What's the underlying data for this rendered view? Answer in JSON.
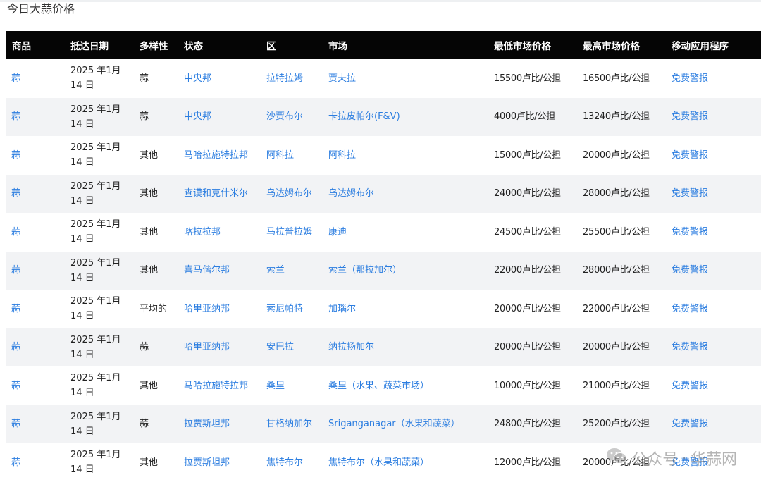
{
  "heading": "今日大蒜价格",
  "columns": [
    "商品",
    "抵达日期",
    "多样性",
    "状态",
    "区",
    "市场",
    "最低市场价格",
    "最高市场价格",
    "移动应用程序"
  ],
  "rows": [
    {
      "commodity": "蒜",
      "date": "2025 年1月 14 日",
      "variety": "蒜",
      "state": "中央邦",
      "district": "拉特拉姆",
      "market": "贾夫拉",
      "min": "15500卢比/公担",
      "max": "16500卢比/公担",
      "app": "免费警报"
    },
    {
      "commodity": "蒜",
      "date": "2025 年1月 14 日",
      "variety": "蒜",
      "state": "中央邦",
      "district": "沙贾布尔",
      "market": "卡拉皮帕尔(F&V)",
      "min": "4000卢比/公担",
      "max": "13240卢比/公担",
      "app": "免费警报"
    },
    {
      "commodity": "蒜",
      "date": "2025 年1月 14 日",
      "variety": "其他",
      "state": "马哈拉施特拉邦",
      "district": "阿科拉",
      "market": "阿科拉",
      "min": "15000卢比/公担",
      "max": "20000卢比/公担",
      "app": "免费警报"
    },
    {
      "commodity": "蒜",
      "date": "2025 年1月 14 日",
      "variety": "其他",
      "state": "查谟和克什米尔",
      "district": "乌达姆布尔",
      "market": "乌达姆布尔",
      "min": "24000卢比/公担",
      "max": "28000卢比/公担",
      "app": "免费警报"
    },
    {
      "commodity": "蒜",
      "date": "2025 年1月 14 日",
      "variety": "其他",
      "state": "喀拉拉邦",
      "district": "马拉普拉姆",
      "market": "康迪",
      "min": "24500卢比/公担",
      "max": "25500卢比/公担",
      "app": "免费警报"
    },
    {
      "commodity": "蒜",
      "date": "2025 年1月 14 日",
      "variety": "其他",
      "state": "喜马偕尔邦",
      "district": "索兰",
      "market": "索兰（那拉加尔）",
      "min": "22000卢比/公担",
      "max": "28000卢比/公担",
      "app": "免费警报"
    },
    {
      "commodity": "蒜",
      "date": "2025 年1月 14 日",
      "variety": "平均的",
      "state": "哈里亚纳邦",
      "district": "索尼帕特",
      "market": "加瑙尔",
      "min": "20000卢比/公担",
      "max": "22000卢比/公担",
      "app": "免费警报"
    },
    {
      "commodity": "蒜",
      "date": "2025 年1月 14 日",
      "variety": "蒜",
      "state": "哈里亚纳邦",
      "district": "安巴拉",
      "market": "纳拉扬加尔",
      "min": "20000卢比/公担",
      "max": "20000卢比/公担",
      "app": "免费警报"
    },
    {
      "commodity": "蒜",
      "date": "2025 年1月 14 日",
      "variety": "其他",
      "state": "马哈拉施特拉邦",
      "district": "桑里",
      "market": "桑里（水果、蔬菜市场）",
      "min": "10000卢比/公担",
      "max": "21000卢比/公担",
      "app": "免费警报"
    },
    {
      "commodity": "蒜",
      "date": "2025 年1月 14 日",
      "variety": "蒜",
      "state": "拉贾斯坦邦",
      "district": "甘格纳加尔",
      "market": "Sriganganagar（水果和蔬菜）",
      "min": "24800卢比/公担",
      "max": "25200卢比/公担",
      "app": "免费警报"
    },
    {
      "commodity": "蒜",
      "date": "2025 年1月 14 日",
      "variety": "其他",
      "state": "拉贾斯坦邦",
      "district": "焦特布尔",
      "market": "焦特布尔（水果和蔬菜）",
      "min": "12000卢比/公担",
      "max": "20000卢比/公担",
      "app": "免费警报"
    }
  ],
  "watermark": {
    "label": "公众号",
    "separator": "·",
    "name": "华蒜网",
    "icon": "wechat-icon"
  },
  "colors": {
    "header_bg": "#050505",
    "link": "#2b7de0",
    "stripe": "#f2f3f5"
  }
}
